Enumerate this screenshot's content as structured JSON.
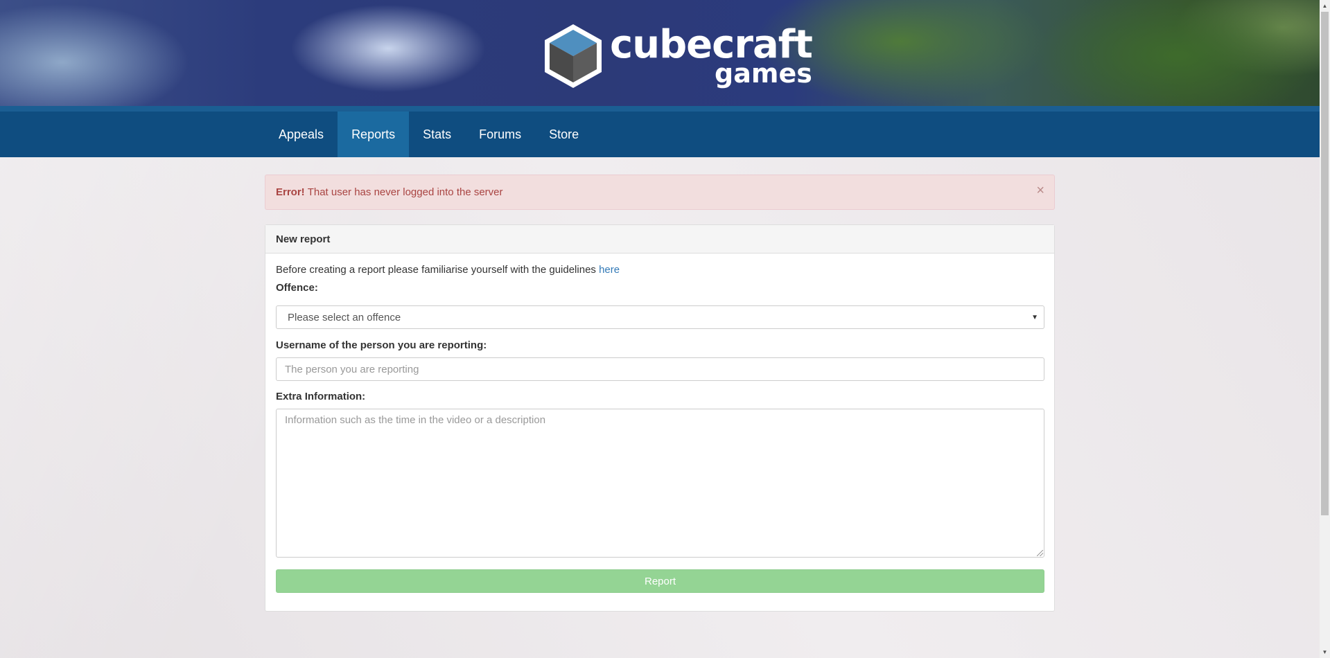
{
  "header": {
    "logo_line1": "cubecraft",
    "logo_line2": "games"
  },
  "nav": {
    "items": [
      {
        "label": "Appeals",
        "active": false
      },
      {
        "label": "Reports",
        "active": true
      },
      {
        "label": "Stats",
        "active": false
      },
      {
        "label": "Forums",
        "active": false
      },
      {
        "label": "Store",
        "active": false
      }
    ]
  },
  "alert": {
    "strong": "Error!",
    "message": "That user has never logged into the server",
    "close": "×"
  },
  "panel": {
    "title": "New report",
    "intro_text": "Before creating a report please familiarise yourself with the guidelines",
    "intro_link": "here",
    "offence_label": "Offence:",
    "offence_value": "Please select an offence",
    "username_label": "Username of the person you are reporting:",
    "username_placeholder": "The person you are reporting",
    "extra_label": "Extra Information:",
    "extra_placeholder": "Information such as the time in the video or a description",
    "submit_label": "Report"
  },
  "colors": {
    "navbar": "#0f4d80",
    "nav_active": "#1b6aa0",
    "alert_bg": "#f2dede",
    "alert_text": "#a94442",
    "button_bg": "#94d494",
    "link": "#337ab7"
  }
}
